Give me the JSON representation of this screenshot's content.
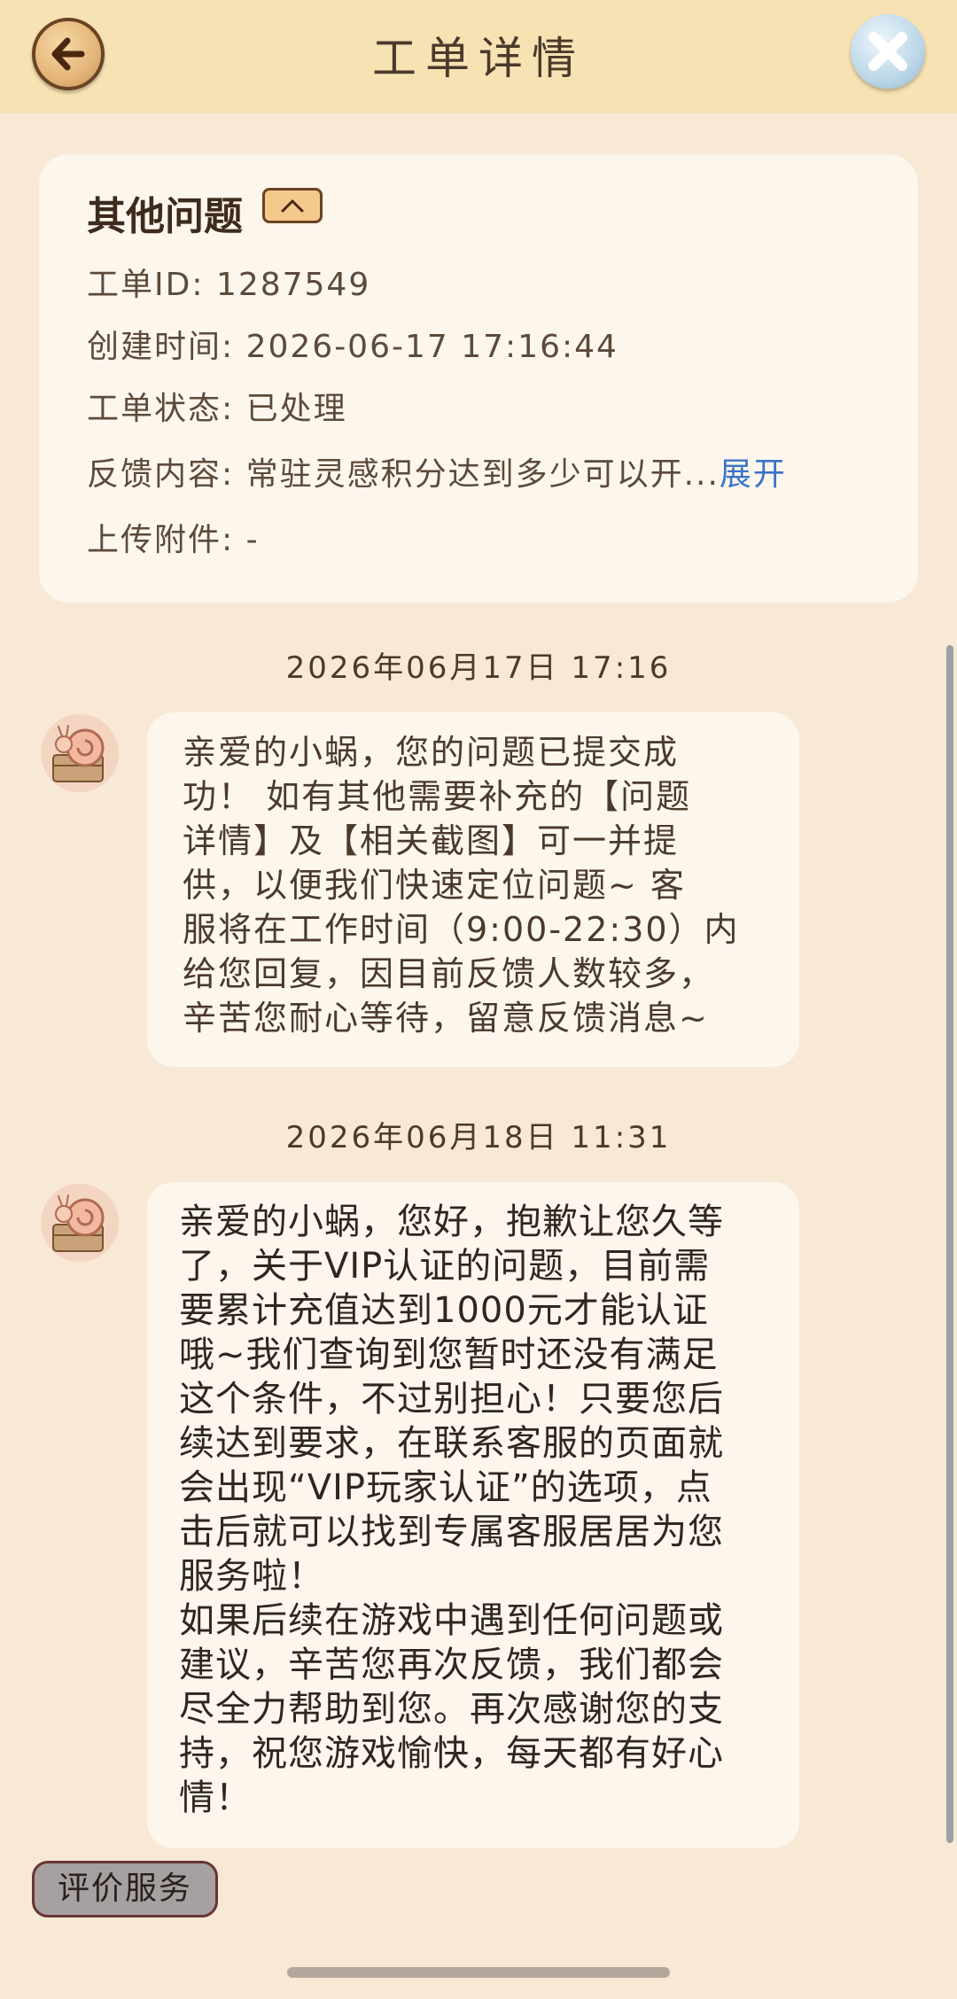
{
  "header": {
    "title": "工单详情"
  },
  "ticket": {
    "category": "其他问题",
    "id_line": "工单ID: 1287549",
    "created_line": "创建时间: 2026-06-17 17:16:44",
    "status_line": "工单状态: 已处理",
    "feedback_prefix": "反馈内容: 常驻灵感积分达到多少可以开...",
    "expand_label": "展开",
    "attachment_line": "上传附件: -"
  },
  "messages": [
    {
      "timestamp": "2026年06月17日 17:16",
      "text": "亲爱的小蜗，您的问题已提交成\n功！ 如有其他需要补充的【问题\n详情】及【相关截图】可一并提\n供，以便我们快速定位问题~ 客\n服将在工作时间（9:00-22:30）内\n给您回复，因目前反馈人数较多，\n辛苦您耐心等待，留意反馈消息~"
    },
    {
      "timestamp": "2026年06月18日 11:31",
      "text": "亲爱的小蜗，您好，抱歉让您久等\n了，关于VIP认证的问题，目前需\n要累计充值达到1000元才能认证\n哦~我们查询到您暂时还没有满足\n这个条件，不过别担心！只要您后\n续达到要求，在联系客服的页面就\n会出现“VIP玩家认证”的选项，点\n击后就可以找到专属客服居居为您\n服务啦！\n如果后续在游戏中遇到任何问题或\n建议，辛苦您再次反馈，我们都会\n尽全力帮助到您。再次感谢您的支\n持，祝您游戏愉快，每天都有好心\n情！"
    }
  ],
  "footer": {
    "rate_label": "评价服务"
  },
  "icons": {
    "back": "back-arrow-icon",
    "close": "close-icon",
    "collapse": "chevron-up-icon",
    "avatar": "snail-avatar-icon"
  },
  "colors": {
    "background": "#f7e9d6",
    "header": "#f6e2b3",
    "card": "#fdf6ec",
    "link": "#3b73c8",
    "rate_button": "#a6a0a0"
  }
}
